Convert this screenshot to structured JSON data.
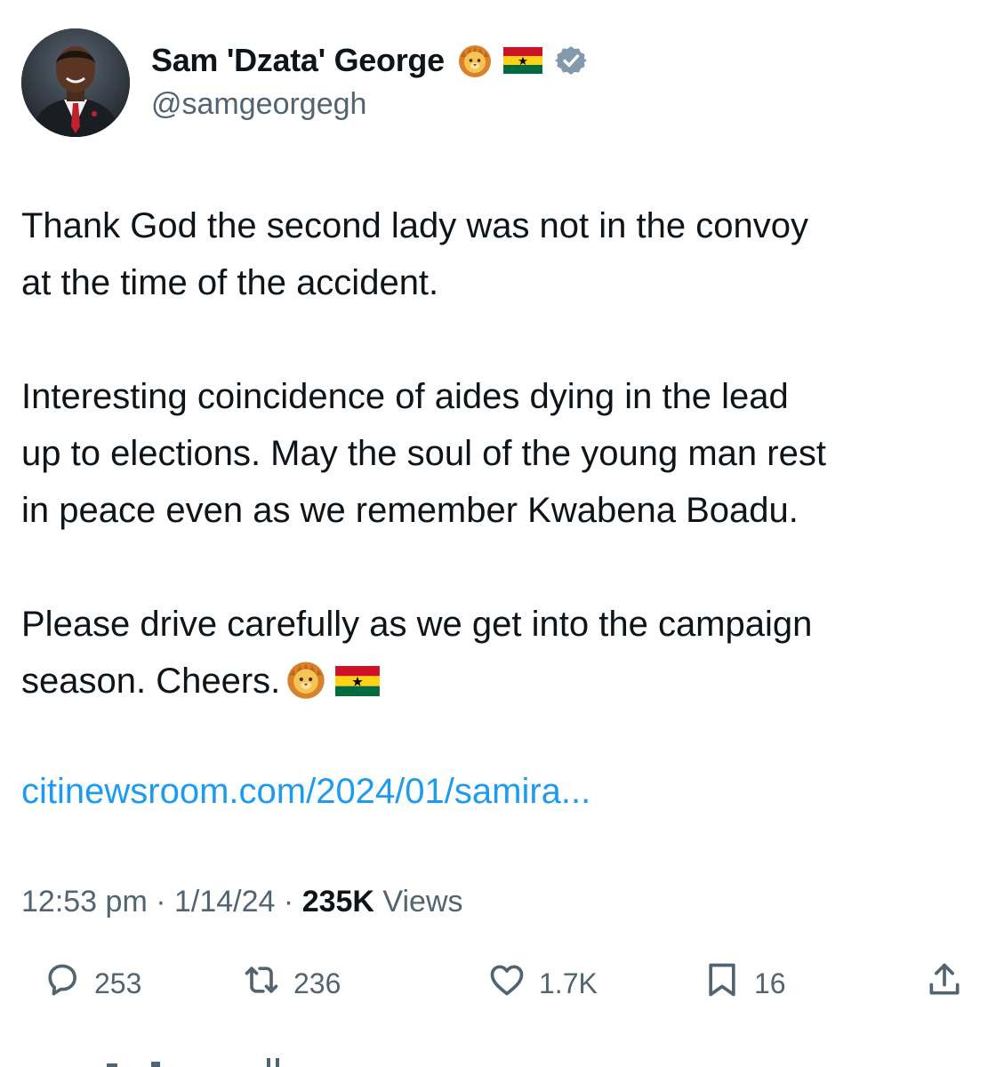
{
  "user": {
    "display_name": "Sam 'Dzata' George",
    "handle": "@samgeorgegh",
    "name_emojis": [
      "lion-face-emoji",
      "ghana-flag-emoji"
    ],
    "verified_badge": "verified-badge-icon"
  },
  "tweet": {
    "paragraphs": [
      {
        "lines": [
          "Thank God the second lady was not in the convoy",
          "at the time of the accident."
        ]
      },
      {
        "lines": [
          "Interesting coincidence of aides dying in the lead",
          "up to elections. May the soul of the young man rest",
          "in peace even as we remember Kwabena Boadu."
        ]
      },
      {
        "lines": [
          "Please drive carefully as we get into the campaign",
          "season. Cheers."
        ]
      }
    ],
    "trailing_emojis": [
      "lion-face-emoji",
      "ghana-flag-emoji"
    ],
    "link": "citinewsroom.com/2024/01/samira..."
  },
  "meta": {
    "time": "12:53 pm",
    "separator": "·",
    "date": "1/14/24",
    "views_count": "235K",
    "views_label": "Views"
  },
  "actions": {
    "reply": {
      "icon": "reply-icon",
      "count": "253"
    },
    "repost": {
      "icon": "repost-icon",
      "count": "236"
    },
    "like": {
      "icon": "heart-icon",
      "count": "1.7K"
    },
    "bookmark": {
      "icon": "bookmark-icon",
      "count": "16"
    },
    "share": {
      "icon": "share-icon"
    }
  },
  "colors": {
    "text": "#0f1419",
    "secondary": "#536471",
    "link": "#1d9bf0",
    "verified": "#829aab",
    "flag_red": "#ce1126",
    "flag_gold": "#fcd116",
    "flag_green": "#006b3f"
  }
}
